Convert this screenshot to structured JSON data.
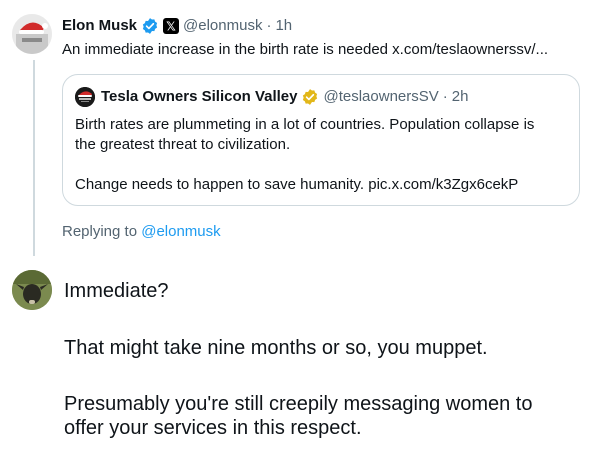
{
  "parent_tweet": {
    "author_name": "Elon Musk",
    "x_badge": "𝕏",
    "handle": "@elonmusk",
    "separator": "·",
    "time": "1h",
    "text": "An immediate increase in the birth rate is needed x.com/teslaownerssv/..."
  },
  "quote": {
    "author_name": "Tesla Owners Silicon Valley",
    "handle": "@teslaownersSV",
    "separator": "·",
    "time": "2h",
    "line1": "Birth rates are plummeting in a lot of countries. Population collapse is",
    "line2": "the greatest threat to civilization.",
    "line3": "Change needs to happen to save humanity. pic.x.com/k3Zgx6cekP"
  },
  "replying": {
    "prefix": "Replying to",
    "handle": "@elonmusk"
  },
  "reply": {
    "para1": "Immediate?",
    "para2": "That might take nine months or so, you muppet.",
    "para3_line1": "Presumably you're still creepily messaging women to",
    "para3_line2": "offer your services in this respect."
  },
  "colors": {
    "verified_blue": "#1d9bf0",
    "verified_gold": "#e2b719",
    "muted_text": "#536471",
    "border": "#cfd9de"
  },
  "icons": {
    "verified_blue": "verified-badge-blue-icon",
    "verified_gold": "verified-badge-gold-icon"
  }
}
